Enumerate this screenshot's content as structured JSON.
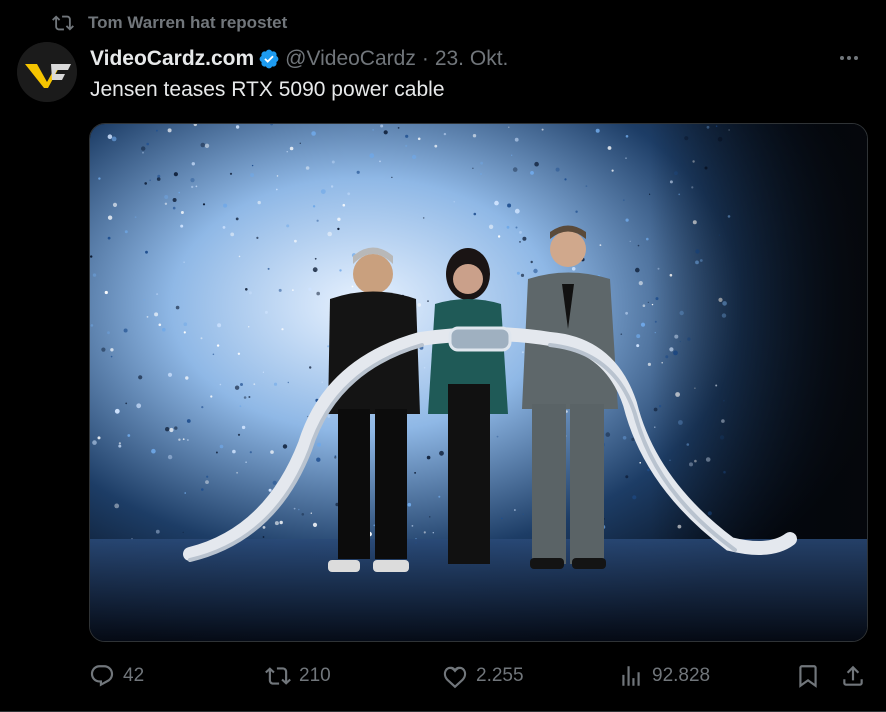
{
  "repost": {
    "text": "Tom Warren hat repostet",
    "icon": "repost-icon"
  },
  "tweet": {
    "display_name": "VideoCardz.com",
    "verified": true,
    "handle": "@VideoCardz",
    "separator": "·",
    "date": "23. Okt.",
    "text": "Jensen teases RTX 5090 power cable",
    "image_alt": "Three people on a stage holding a thick braided power cable in front of a sparkling blue and white LED backdrop"
  },
  "actions": {
    "replies": "42",
    "reposts": "210",
    "likes": "2.255",
    "views": "92.828"
  },
  "colors": {
    "background": "#000000",
    "text": "#e7e9ea",
    "muted": "#71767b",
    "verified": "#1d9bf0",
    "logo_yellow": "#f5c400"
  }
}
